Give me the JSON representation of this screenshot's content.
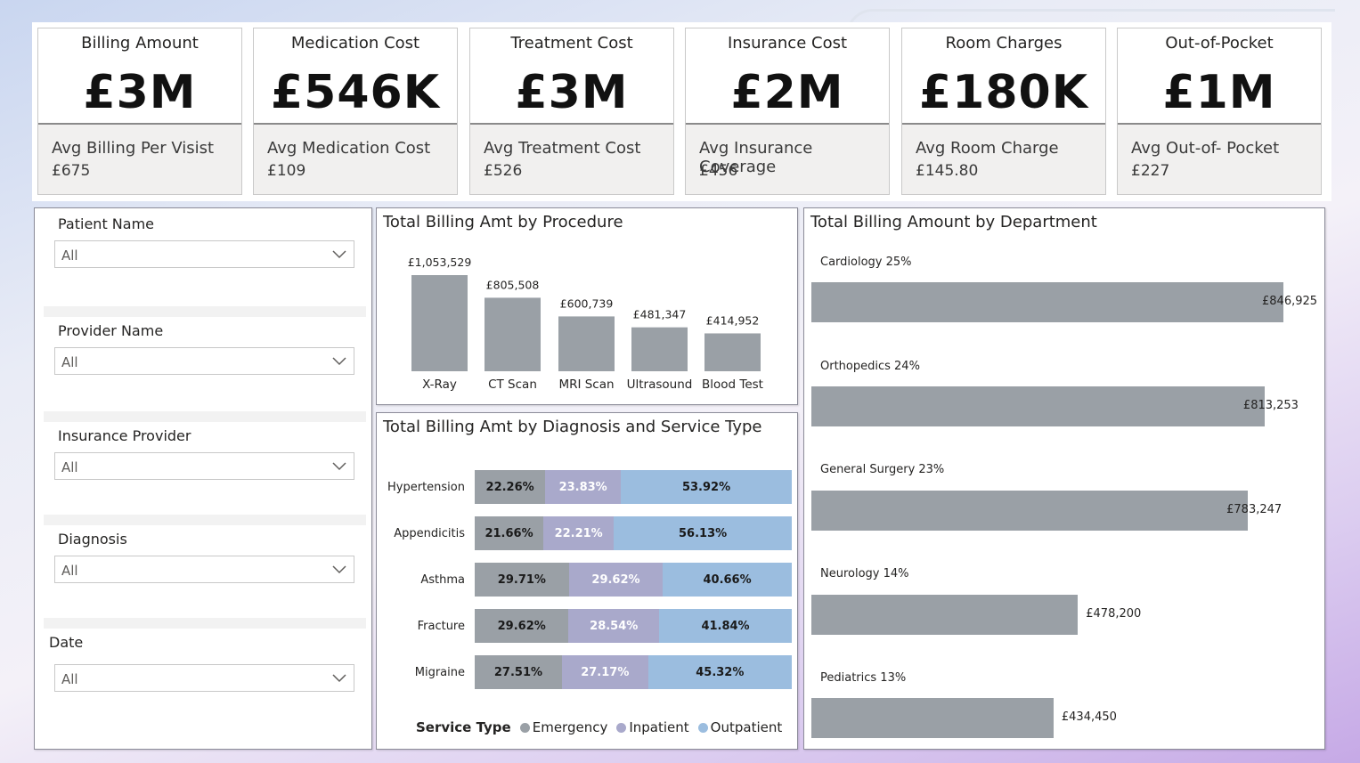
{
  "kpis": [
    {
      "title": "Billing Amount",
      "value": "£3M",
      "sub_label": "Avg Billing Per Visist",
      "sub_value": "£675"
    },
    {
      "title": "Medication Cost",
      "value": "£546K",
      "sub_label": "Avg Medication Cost",
      "sub_value": "£109"
    },
    {
      "title": "Treatment Cost",
      "value": "£3M",
      "sub_label": "Avg Treatment Cost",
      "sub_value": "£526"
    },
    {
      "title": "Insurance Cost",
      "value": "£2M",
      "sub_label": "Avg Insurance Coverage",
      "sub_value": "£456"
    },
    {
      "title": "Room Charges",
      "value": "£180K",
      "sub_label": "Avg Room Charge",
      "sub_value": "£145.80"
    },
    {
      "title": "Out-of-Pocket",
      "value": "£1M",
      "sub_label": "Avg Out-of- Pocket",
      "sub_value": "£227"
    }
  ],
  "slicers": [
    {
      "label": "Patient Name",
      "value": "All",
      "icon": "chevron-down-icon"
    },
    {
      "label": "Provider Name",
      "value": "All",
      "icon": "chevron-down-icon"
    },
    {
      "label": "Insurance Provider",
      "value": "All",
      "icon": "chevron-down-icon"
    },
    {
      "label": "Diagnosis",
      "value": "All",
      "icon": "chevron-down-icon"
    },
    {
      "label": "Date",
      "value": "All",
      "icon": "chevron-down-icon"
    }
  ],
  "colors": {
    "bar": "#9aa0a6",
    "emergency": "#9aa0a6",
    "inpatient": "#a9a9cb",
    "outpatient": "#9bbddf"
  },
  "chart_data": [
    {
      "type": "bar",
      "title": "Total Billing Amt by Procedure",
      "categories": [
        "X-Ray",
        "CT Scan",
        "MRI Scan",
        "Ultrasound",
        "Blood Test"
      ],
      "values": [
        1053529,
        805508,
        600739,
        481347,
        414952
      ],
      "labels": [
        "£1,053,529",
        "£805,508",
        "£600,739",
        "£481,347",
        "£414,952"
      ]
    },
    {
      "type": "bar",
      "stacked": "100%",
      "orientation": "horizontal",
      "title": "Total Billing Amt by Diagnosis and Service Type",
      "categories": [
        "Hypertension",
        "Appendicitis",
        "Asthma",
        "Fracture",
        "Migraine"
      ],
      "legend_title": "Service Type",
      "series": [
        {
          "name": "Emergency",
          "values": [
            22.26,
            21.66,
            29.71,
            29.62,
            27.51
          ],
          "labels": [
            "22.26%",
            "21.66%",
            "29.71%",
            "29.62%",
            "27.51%"
          ]
        },
        {
          "name": "Inpatient",
          "values": [
            23.83,
            22.21,
            29.62,
            28.54,
            27.17
          ],
          "labels": [
            "23.83%",
            "22.21%",
            "29.62%",
            "28.54%",
            "27.17%"
          ]
        },
        {
          "name": "Outpatient",
          "values": [
            53.92,
            56.13,
            40.66,
            41.84,
            45.32
          ],
          "labels": [
            "53.92%",
            "56.13%",
            "40.66%",
            "41.84%",
            "45.32%"
          ]
        }
      ]
    },
    {
      "type": "bar",
      "orientation": "horizontal",
      "title": "Total Billing Amount by Department",
      "categories": [
        "Cardiology 25%",
        "Orthopedics 24%",
        "General Surgery 23%",
        "Neurology 14%",
        "Pediatrics 13%"
      ],
      "values": [
        846925,
        813253,
        783247,
        478200,
        434450
      ],
      "labels": [
        "£846,925",
        "£813,253",
        "£783,247",
        "£478,200",
        "£434,450"
      ]
    }
  ]
}
